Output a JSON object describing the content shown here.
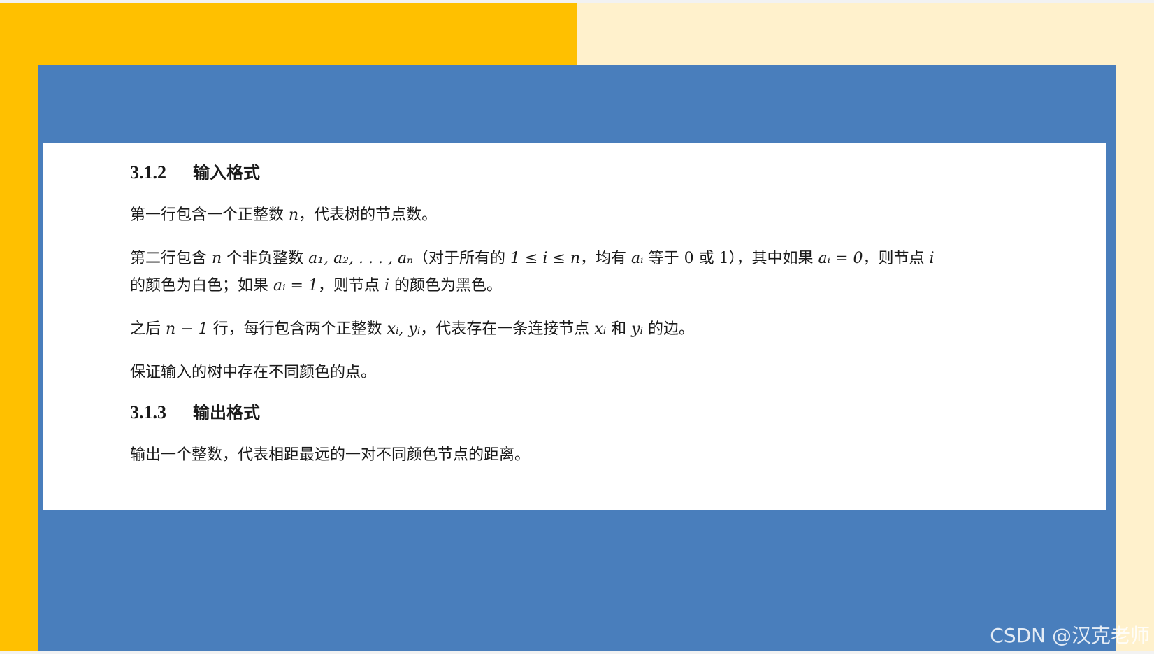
{
  "section_312": {
    "number": "3.1.2",
    "title": "输入格式"
  },
  "p1": {
    "a": "第一行包含一个正整数 ",
    "n": "n",
    "b": "，代表树的节点数。"
  },
  "p2": {
    "a": "第二行包含 ",
    "n": "n",
    "b": " 个非负整数 ",
    "seq": "a₁, a₂, . . . , aₙ",
    "c": "（对于所有的 ",
    "cond": "1 ≤ i ≤ n",
    "d": "，均有 ",
    "ai": "aᵢ",
    "e": " 等于 0 或 1），其中如果 ",
    "ai0": "aᵢ = 0",
    "f": "，则节点 ",
    "i": "i",
    "g": "的颜色为白色；如果 ",
    "ai1": "aᵢ = 1",
    "h": "，则节点 ",
    "i2": "i",
    "k": " 的颜色为黑色。"
  },
  "p3": {
    "a": "之后 ",
    "nm1": "n − 1",
    "b": " 行，每行包含两个正整数 ",
    "xy": "xᵢ, yᵢ",
    "c": "，代表存在一条连接节点 ",
    "xi": "xᵢ",
    "d": " 和 ",
    "yi": "yᵢ",
    "e": " 的边。"
  },
  "p4": "保证输入的树中存在不同颜色的点。",
  "section_313": {
    "number": "3.1.3",
    "title": "输出格式"
  },
  "p5": "输出一个整数，代表相距最远的一对不同颜色节点的距离。",
  "watermark": "CSDN @汉克老师",
  "colors": {
    "yellow": "#ffc000",
    "cream": "#fff1cc",
    "blue": "#497ebc",
    "white": "#ffffff"
  }
}
